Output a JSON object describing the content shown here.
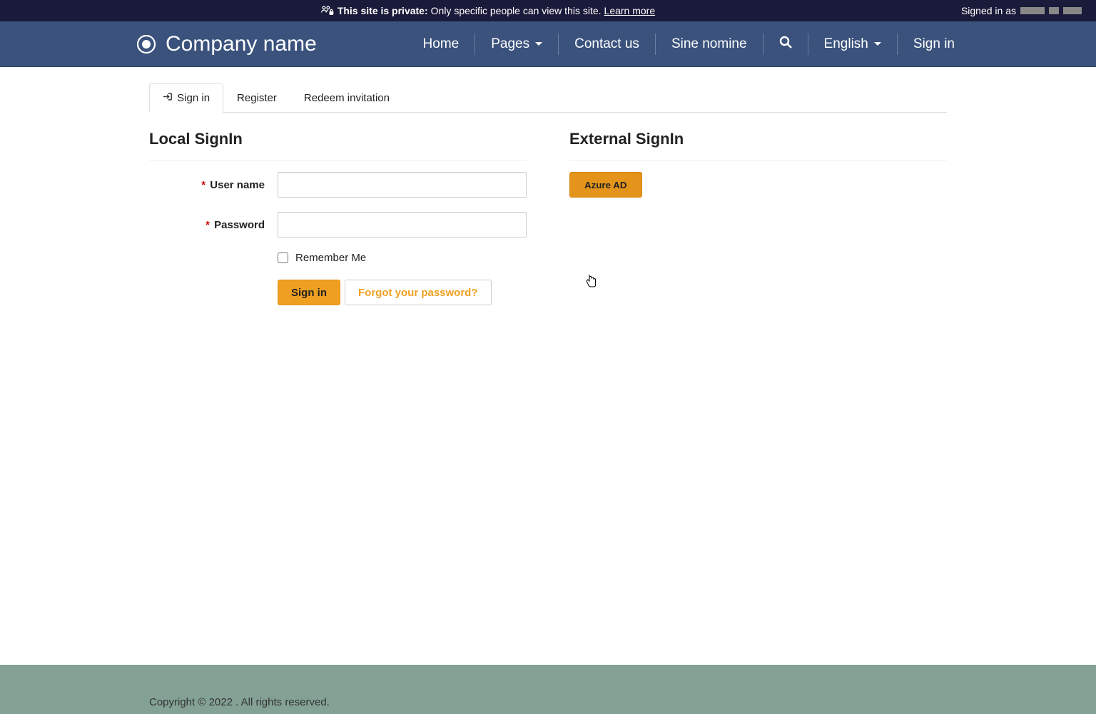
{
  "private_bar": {
    "bold": "This site is private:",
    "text": "Only specific people can view this site.",
    "learn_more": "Learn more",
    "signed_in_as": "Signed in as"
  },
  "navbar": {
    "brand": "Company name",
    "items": {
      "home": "Home",
      "pages": "Pages",
      "contact": "Contact us",
      "sine": "Sine nomine",
      "english": "English",
      "signin": "Sign in"
    }
  },
  "tabs": {
    "signin": "Sign in",
    "register": "Register",
    "redeem": "Redeem invitation"
  },
  "local": {
    "heading": "Local SignIn",
    "username_label": "User name",
    "password_label": "Password",
    "remember": "Remember Me",
    "signin_btn": "Sign in",
    "forgot": "Forgot your password?"
  },
  "external": {
    "heading": "External SignIn",
    "azure_btn": "Azure AD"
  },
  "footer": {
    "copyright": "Copyright © 2022 . All rights reserved."
  }
}
